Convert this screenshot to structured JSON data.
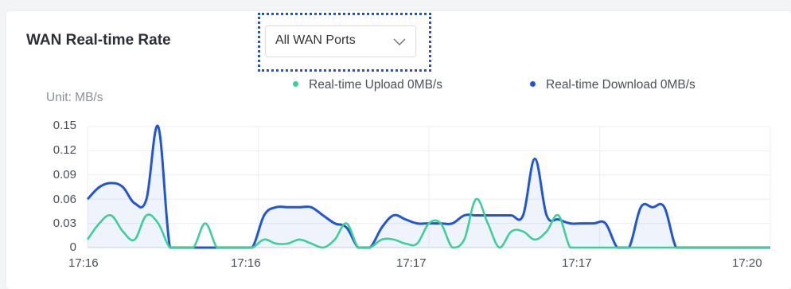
{
  "widget": {
    "title": "WAN Real-time Rate",
    "port_select": {
      "value": "All WAN Ports",
      "icon": "chevron-down-icon"
    }
  },
  "legend": {
    "upload": {
      "label": "Real-time Upload 0MB/s",
      "color": "#3dd096"
    },
    "download": {
      "label": "Real-time Download 0MB/s",
      "color": "#1f56d6"
    }
  },
  "chart_data": {
    "type": "area",
    "unit_label": "Unit: MB/s",
    "y_ticks": [
      "0.15",
      "0.12",
      "0.09",
      "0.06",
      "0.03",
      "0"
    ],
    "x_ticks": [
      "17:16",
      "17:16",
      "17:17",
      "17:17",
      "17:20"
    ],
    "ylim": [
      0,
      0.15
    ],
    "grid": true,
    "x": [
      0,
      1,
      2,
      3,
      4,
      5,
      6,
      7,
      8,
      9,
      10,
      11,
      12,
      13,
      14,
      15,
      16,
      17,
      18,
      19,
      20,
      21,
      22,
      23,
      24,
      25,
      26,
      27,
      28,
      29,
      30,
      31,
      32,
      33,
      34,
      35,
      36,
      37,
      38,
      39,
      40,
      41,
      42,
      43,
      44,
      45,
      46,
      47,
      48,
      49,
      50,
      51,
      52,
      53,
      54,
      55,
      56,
      57,
      58
    ],
    "series": [
      {
        "name": "Real-time Upload",
        "color": "#3dd096",
        "values": [
          0.01,
          0.03,
          0.04,
          0.02,
          0.01,
          0.04,
          0.03,
          0,
          0,
          0,
          0.03,
          0,
          0,
          0,
          0,
          0.01,
          0.005,
          0.005,
          0.01,
          0.005,
          0,
          0.01,
          0.03,
          0,
          0,
          0.01,
          0.01,
          0.005,
          0.005,
          0.03,
          0.03,
          0,
          0.01,
          0.06,
          0.03,
          0,
          0.02,
          0.02,
          0.01,
          0.02,
          0.04,
          0,
          0,
          0,
          0,
          0,
          0,
          0,
          0,
          0,
          0,
          0,
          0,
          0,
          0,
          0,
          0,
          0,
          0
        ]
      },
      {
        "name": "Real-time Download",
        "color": "#1f56d6",
        "values": [
          0.06,
          0.075,
          0.08,
          0.075,
          0.055,
          0.06,
          0.15,
          0,
          0,
          0,
          0,
          0,
          0,
          0,
          0,
          0.04,
          0.05,
          0.05,
          0.05,
          0.05,
          0.04,
          0.03,
          0.025,
          0,
          0,
          0.025,
          0.04,
          0.035,
          0.03,
          0.03,
          0.03,
          0.03,
          0.04,
          0.04,
          0.04,
          0.04,
          0.04,
          0.04,
          0.11,
          0.04,
          0.035,
          0.03,
          0.03,
          0.03,
          0.03,
          0,
          0,
          0.05,
          0.05,
          0.05,
          0,
          0,
          0,
          0,
          0,
          0,
          0,
          0,
          0
        ]
      }
    ]
  }
}
